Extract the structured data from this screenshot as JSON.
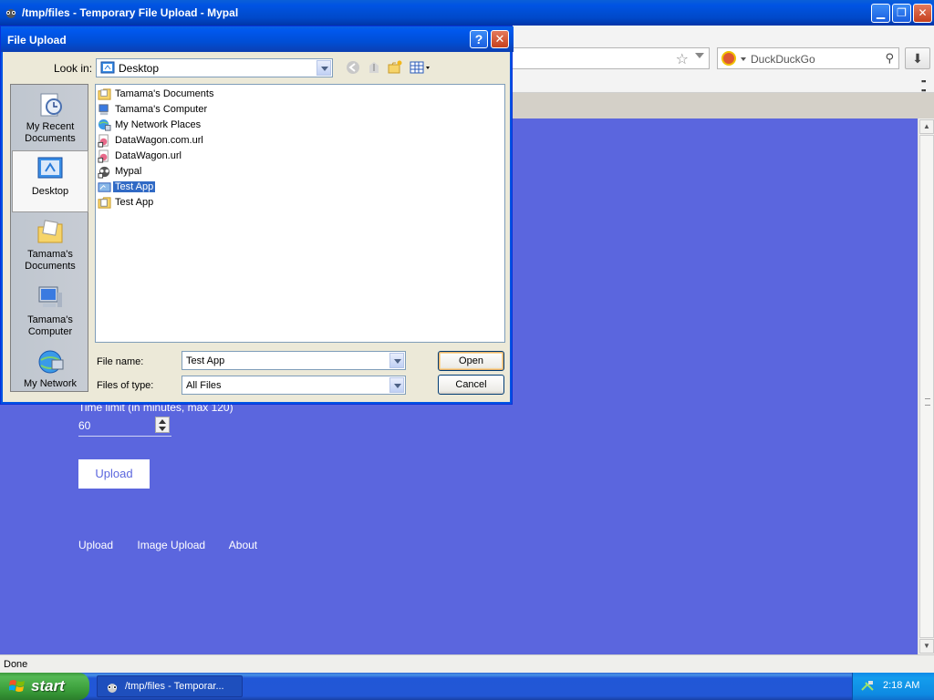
{
  "browser": {
    "title": "/tmp/files - Temporary File Upload - Mypal",
    "search_placeholder": "DuckDuckGo",
    "status": "Done"
  },
  "page": {
    "time_limit_label": "Time limit (in minutes, max 120)",
    "time_limit_value": "60",
    "upload_button": "Upload",
    "nav_links": [
      "Upload",
      "Image Upload",
      "About"
    ],
    "background_color": "#5b66de"
  },
  "dialog": {
    "title": "File Upload",
    "help_button": "?",
    "close_button": "✕",
    "look_in_label": "Look in:",
    "look_in_value": "Desktop",
    "places": [
      {
        "label": "My Recent Documents",
        "icon": "recent-documents-icon"
      },
      {
        "label": "Desktop",
        "icon": "desktop-icon",
        "selected": true
      },
      {
        "label": "Tamama's Documents",
        "icon": "documents-folder-icon"
      },
      {
        "label": "Tamama's Computer",
        "icon": "computer-icon"
      },
      {
        "label": "My Network",
        "icon": "network-icon"
      }
    ],
    "files": [
      {
        "name": "Tamama's Documents",
        "icon": "folder-icon"
      },
      {
        "name": "Tamama's Computer",
        "icon": "computer-icon"
      },
      {
        "name": "My Network Places",
        "icon": "network-icon"
      },
      {
        "name": "DataWagon.com.url",
        "icon": "url-shortcut-icon"
      },
      {
        "name": "DataWagon.url",
        "icon": "url-shortcut-icon"
      },
      {
        "name": "Mypal",
        "icon": "app-shortcut-icon"
      },
      {
        "name": "Test App",
        "icon": "shortcut-icon",
        "selected": true
      },
      {
        "name": "Test App",
        "icon": "folder-icon"
      }
    ],
    "file_name_label": "File name:",
    "file_name_value": "Test App",
    "file_type_label": "Files of type:",
    "file_type_value": "All Files",
    "open_button": "Open",
    "cancel_button": "Cancel"
  },
  "taskbar": {
    "start_label": "start",
    "task_label": "/tmp/files - Temporar...",
    "clock": "2:18 AM"
  }
}
